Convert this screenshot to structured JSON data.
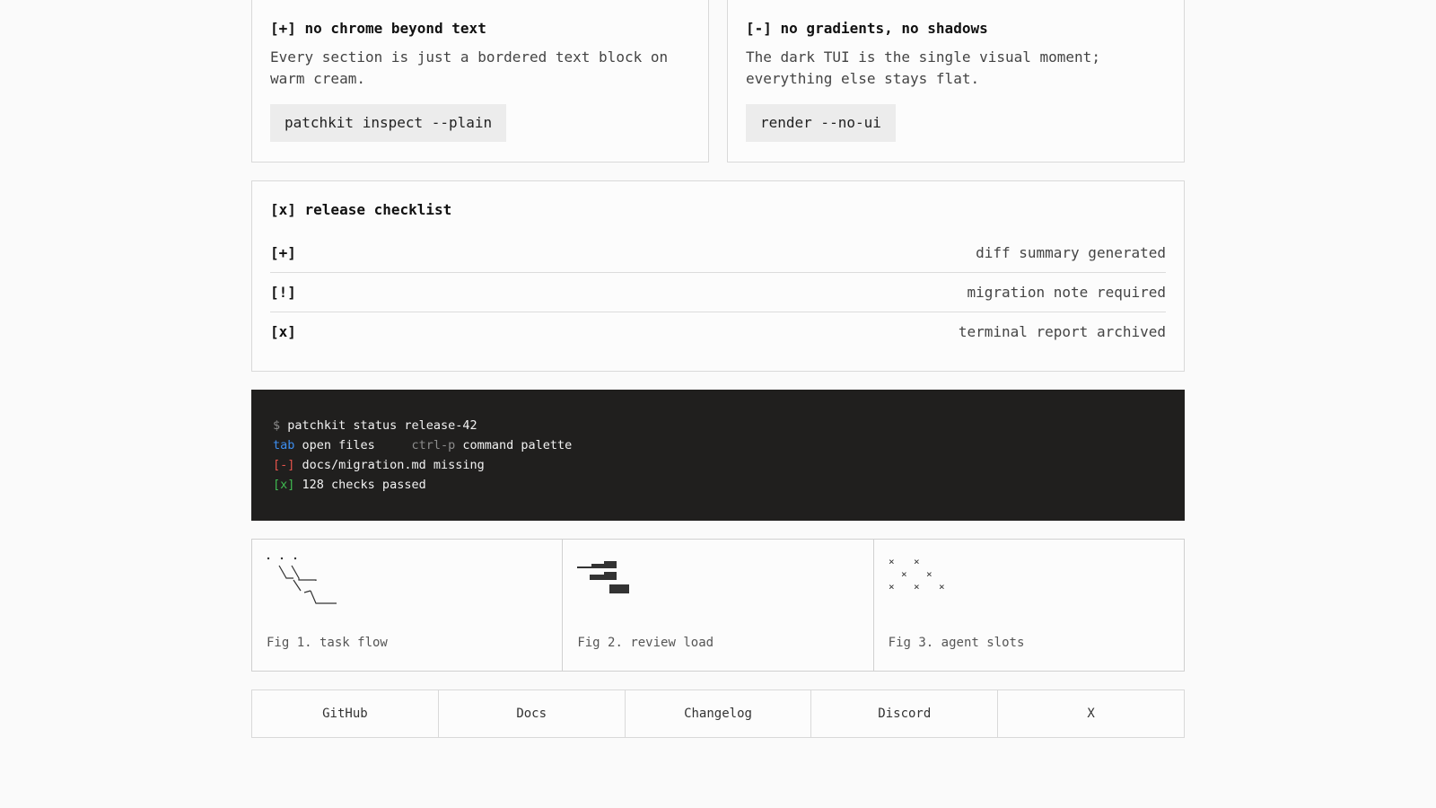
{
  "cards": [
    {
      "title": "[+] no chrome beyond text",
      "body": "Every section is just a bordered text block on warm cream.",
      "command": "patchkit inspect --plain"
    },
    {
      "title": "[-] no gradients, no shadows",
      "body": "The dark TUI is the single visual moment; everything else stays flat.",
      "command": "render --no-ui"
    }
  ],
  "checklist": {
    "title": "[x] release checklist",
    "items": [
      {
        "mark": "[+]",
        "text": "diff summary generated"
      },
      {
        "mark": "[!]",
        "text": "migration note required"
      },
      {
        "mark": "[x]",
        "text": "terminal report archived"
      }
    ]
  },
  "terminal": {
    "prompt": "$",
    "command": "patchkit status release-42",
    "key1": "tab",
    "key1_action": "open files",
    "key2": "ctrl-p",
    "key2_action": "command palette",
    "line3_mark": "[-]",
    "line3_text": "docs/migration.md missing",
    "line4_mark": "[x]",
    "line4_text": "128 checks passed",
    "colors": {
      "background": "#201f1e",
      "blue": "#3d8ef0",
      "red": "#e5534b",
      "green": "#3fb950"
    }
  },
  "figures": [
    {
      "caption": "Fig 1. task flow",
      "icon": "task-flow-icon"
    },
    {
      "caption": "Fig 2. review load",
      "icon": "review-load-icon"
    },
    {
      "caption": "Fig 3. agent slots",
      "icon": "agent-slots-icon"
    }
  ],
  "links": [
    "GitHub",
    "Docs",
    "Changelog",
    "Discord",
    "X"
  ]
}
